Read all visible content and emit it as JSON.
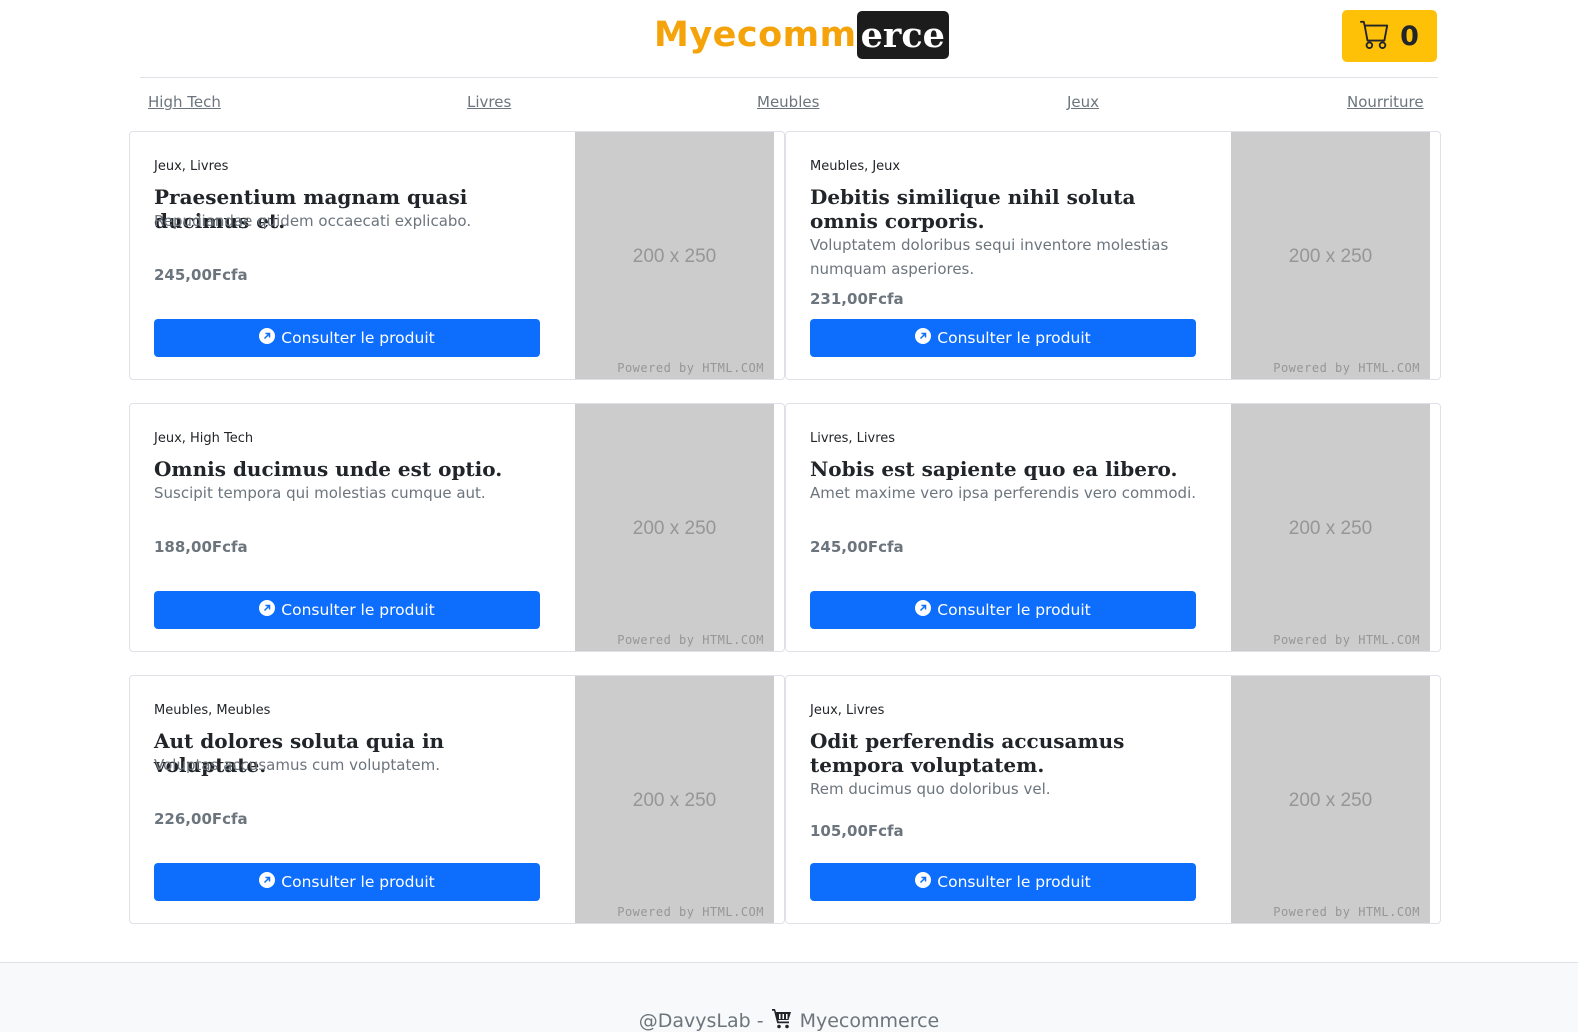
{
  "header": {
    "logo_part1": "Myecomm",
    "logo_part2": "erce",
    "cart_count": "0",
    "cart_icon": "cart-icon"
  },
  "nav": [
    "High Tech",
    "Livres",
    "Meubles",
    "Jeux",
    "Nourriture"
  ],
  "products": [
    {
      "categories": "Jeux, Livres",
      "title": "Praesentium magnam quasi ducimus et.",
      "description": "Repudiandae quidem occaecati explicabo.",
      "price": "245,00Fcfa",
      "button": "Consulter le produit",
      "image_label": "200 x 250",
      "image_credit": "Powered by HTML.COM"
    },
    {
      "categories": "Meubles, Jeux",
      "title": "Debitis similique nihil soluta omnis corporis.",
      "description": "Voluptatem doloribus sequi inventore molestias numquam asperiores.",
      "price": "231,00Fcfa",
      "button": "Consulter le produit",
      "image_label": "200 x 250",
      "image_credit": "Powered by HTML.COM"
    },
    {
      "categories": "Jeux, High Tech",
      "title": "Omnis ducimus unde est optio.",
      "description": "Suscipit tempora qui molestias cumque aut.",
      "price": "188,00Fcfa",
      "button": "Consulter le produit",
      "image_label": "200 x 250",
      "image_credit": "Powered by HTML.COM"
    },
    {
      "categories": "Livres, Livres",
      "title": "Nobis est sapiente quo ea libero.",
      "description": "Amet maxime vero ipsa perferendis vero commodi.",
      "price": "245,00Fcfa",
      "button": "Consulter le produit",
      "image_label": "200 x 250",
      "image_credit": "Powered by HTML.COM"
    },
    {
      "categories": "Meubles, Meubles",
      "title": "Aut dolores soluta quia in voluptate.",
      "description": "Voluptas accusamus cum voluptatem.",
      "price": "226,00Fcfa",
      "button": "Consulter le produit",
      "image_label": "200 x 250",
      "image_credit": "Powered by HTML.COM"
    },
    {
      "categories": "Jeux, Livres",
      "title": "Odit perferendis accusamus tempora voluptatem.",
      "description": "Rem ducimus quo doloribus vel.",
      "price": "105,00Fcfa",
      "button": "Consulter le produit",
      "image_label": "200 x 250",
      "image_credit": "Powered by HTML.COM"
    }
  ],
  "footer": {
    "author": "@DavysLab -",
    "brand": "Myecommerce"
  },
  "colors": {
    "accent": "#ffc107",
    "primary": "#0d6efd",
    "logo_orange": "#f5a30a"
  }
}
